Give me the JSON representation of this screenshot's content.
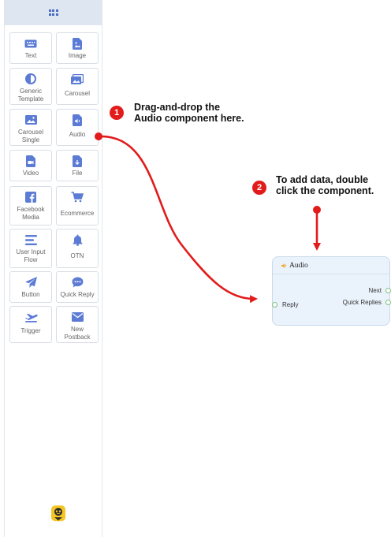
{
  "colors": {
    "accent": "#4b6cc1",
    "arrow": "#e21b1b",
    "node_bg": "#eaf3fb",
    "port": "#7fc27f"
  },
  "sidebar": {
    "header_icon": "grid-icon",
    "tiles": [
      {
        "label": "Text",
        "icon": "keyboard-icon"
      },
      {
        "label": "Image",
        "icon": "image-file-icon"
      },
      {
        "label": "Generic\nTemplate",
        "icon": "half-circle-icon"
      },
      {
        "label": "Carousel",
        "icon": "gallery-icon"
      },
      {
        "label": "Carousel\nSingle",
        "icon": "picture-icon"
      },
      {
        "label": "Audio",
        "icon": "audio-file-icon"
      },
      {
        "label": "Video",
        "icon": "video-file-icon"
      },
      {
        "label": "File",
        "icon": "download-file-icon"
      },
      {
        "label": "Facebook\nMedia",
        "icon": "facebook-icon"
      },
      {
        "label": "Ecommerce",
        "icon": "cart-icon"
      },
      {
        "label": "User Input\nFlow",
        "icon": "lines-icon"
      },
      {
        "label": "OTN",
        "icon": "bell-icon"
      },
      {
        "label": "Button",
        "icon": "send-icon"
      },
      {
        "label": "Quick Reply",
        "icon": "chat-icon"
      },
      {
        "label": "Trigger",
        "icon": "plane-icon"
      },
      {
        "label": "New\nPostback",
        "icon": "envelope-icon"
      }
    ],
    "footer_icon": "bot-icon"
  },
  "steps": [
    {
      "number": "1",
      "text": "Drag-and-drop the\nAudio component here."
    },
    {
      "number": "2",
      "text": "To add data, double\nclick the component."
    }
  ],
  "node": {
    "title": "Audio",
    "icon": "audio-icon",
    "ports": {
      "input": "Reply",
      "output_next": "Next",
      "output_quick": "Quick Replies"
    }
  }
}
